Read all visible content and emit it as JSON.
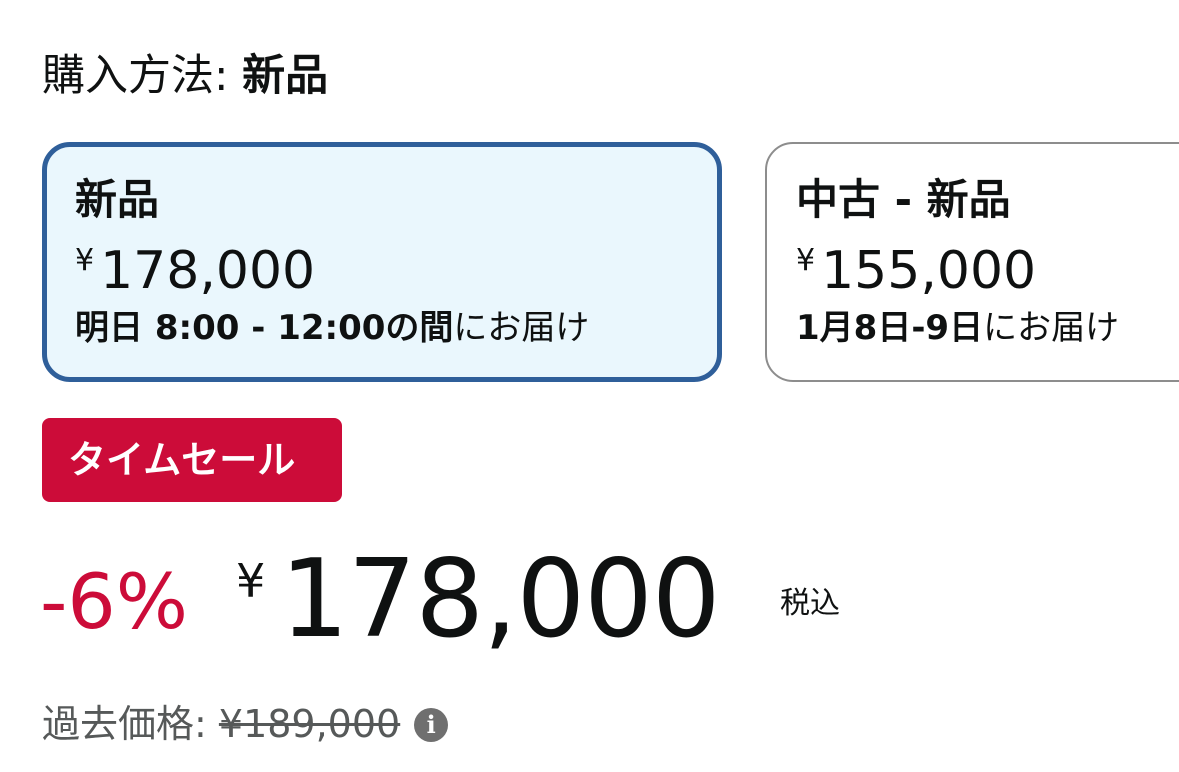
{
  "purchase_method": {
    "label": "購入方法: ",
    "value": "新品"
  },
  "options": [
    {
      "title": "新品",
      "currency": "¥",
      "price": "178,000",
      "delivery_bold": "明日 8:00 - 12:00の間",
      "delivery_rest": "にお届け"
    },
    {
      "title": "中古 - 新品",
      "currency": "¥",
      "price": "155,000",
      "delivery_bold": "1月8日-9日",
      "delivery_rest": "にお届け"
    }
  ],
  "sale_badge": "タイムセール",
  "price": {
    "discount": "-6%",
    "currency": "¥",
    "value": "178,000",
    "tax_note": "税込"
  },
  "past_price": {
    "label": "過去価格: ",
    "value": "¥189,000",
    "icon": "info-icon"
  },
  "colors": {
    "sale_red": "#cc0c39",
    "selected_border": "#2f5f9a",
    "selected_bg": "#eaf7fd"
  }
}
